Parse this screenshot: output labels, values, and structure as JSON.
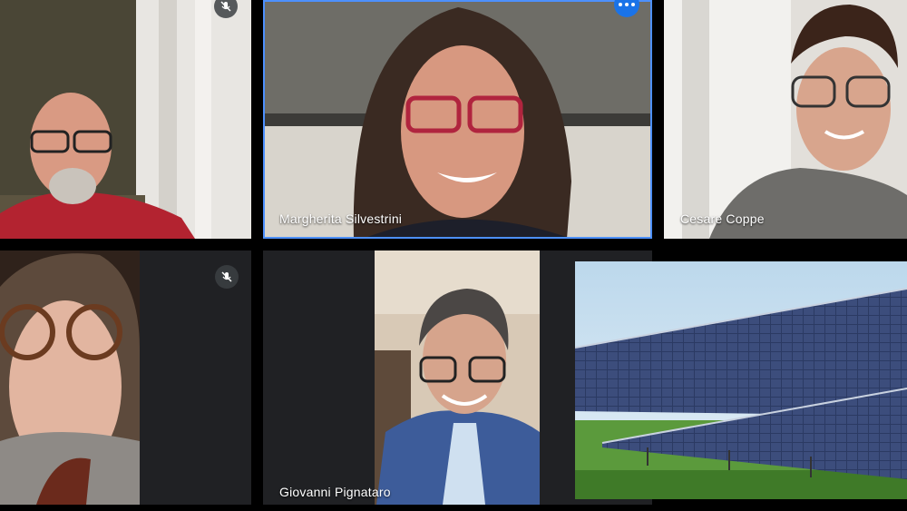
{
  "participants": [
    {
      "id": "p1",
      "name": "",
      "muted": true
    },
    {
      "id": "p2",
      "name": "Margherita Silvestrini",
      "muted": false,
      "active_speaker": true
    },
    {
      "id": "p3",
      "name": "Cesare Coppe",
      "muted": false
    },
    {
      "id": "p4",
      "name": "",
      "muted": true
    },
    {
      "id": "p5",
      "name": "Giovanni Pignataro",
      "muted": false
    }
  ],
  "presentation": {
    "content": "solar-panels-photo"
  },
  "icons": {
    "mic_off": "mic-off-icon",
    "more": "more-options-icon"
  },
  "colors": {
    "active_border": "#4d90fe",
    "more_button": "#1a73e8",
    "tile_background": "#202124"
  }
}
